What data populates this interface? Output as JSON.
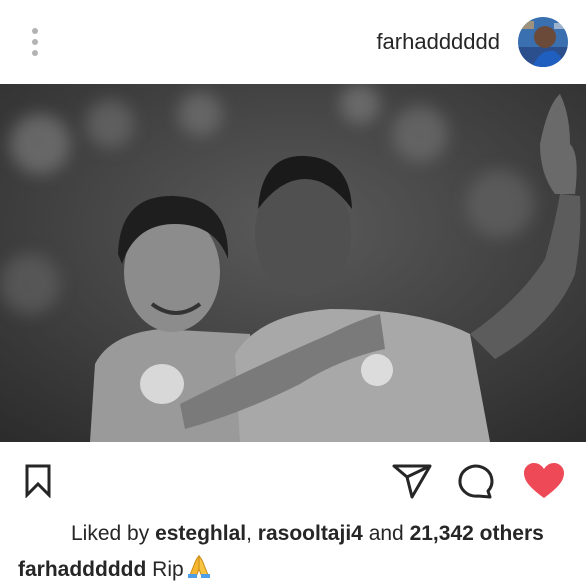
{
  "post": {
    "username": "farhadddddd",
    "likes": {
      "prefix": "Liked by",
      "user1": "esteghlal",
      "separator": ",",
      "user2": "rasooltaji4",
      "and_text": "and",
      "count": "21,342 others"
    },
    "caption": {
      "username": "farhadddddd",
      "text": "Rip",
      "emoji_icon": "folded-hands-icon"
    }
  },
  "icons": {
    "more": "more-vertical-icon",
    "bookmark": "bookmark-icon",
    "share": "send-icon",
    "comment": "comment-icon",
    "like": "heart-icon"
  },
  "colors": {
    "like_red": "#ed4956",
    "dots_gray": "#b3b3b3",
    "text": "#262626"
  }
}
